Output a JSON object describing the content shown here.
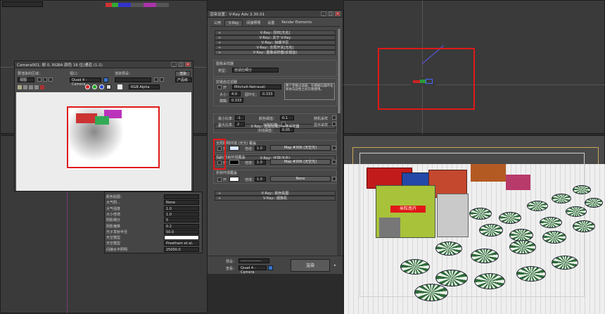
{
  "colors": {
    "highlight": "#e01818",
    "accent_blue": "#3b73c8",
    "viewport_bg": "#3a3a3a",
    "dialog_bg": "#444444"
  },
  "top_field": {
    "value": ""
  },
  "frame_window": {
    "title": "Camera001, 帧 0, RGBA 颜色 16 位/通道 (1:1)",
    "controls": {
      "minimize": "_",
      "maximize": "□",
      "close": "✕"
    },
    "labels": {
      "region": "要渲染的区域：",
      "viewport": "视口：",
      "preset": "渲染预设：",
      "render": "渲染"
    },
    "values": {
      "region": "视图",
      "viewport": "Quad 4 - Camera",
      "preset": "",
      "preset2": "产品级",
      "channel": "RGB Alpha"
    }
  },
  "render_dialog": {
    "title": "渲染设置：V-Ray Adv 2.30.01",
    "tabs": [
      "公用",
      "V-Ray",
      "间接照明",
      "设置",
      "Render Elements"
    ],
    "top_rollouts": [
      "V-Ray:: 授权[无名]",
      "V-Ray:: 关于 V-Ray",
      "V-Ray:: 帧缓冲区",
      "V-Ray:: 全局开关[无名]",
      "V-Ray:: 图像采样器(反锯齿)"
    ],
    "image_sampler": {
      "group": "图像采样器",
      "type_label": "类型：",
      "type_value": "自适应细分"
    },
    "aa_filter": {
      "group": "抗锯齿过滤器",
      "on_label": "开",
      "filter_value": "Mitchell-Netravali",
      "description": "两个参数过滤器：在模糊与圆环化和各向异性之间交替使用。",
      "size_label": "大小：",
      "size_value": "4.0",
      "ring_label": "圆环化：",
      "ring_value": "0.333",
      "blur_label": "模糊：",
      "blur_value": "0.333"
    },
    "adaptive_rollout": "V-Ray:: 自适应细分图像采样器",
    "adaptive": {
      "min_rate_label": "最小比率：",
      "min_rate": "-1",
      "max_rate_label": "最大比率：",
      "max_rate": "2",
      "clr_label": "颜色阈值：",
      "clr_value": "0.1",
      "obj_label": "对象轮廓",
      "normals_label": "法线阈值：",
      "normals_value": "0.05",
      "randomize_label": "随机采样",
      "show_label": "显示采样"
    },
    "env_rollout": "V-Ray:: 环境[无名]",
    "gi_env": {
      "group": "全局照明环境 (天光) 覆盖",
      "on_label": "开",
      "mult_label": "倍增：",
      "mult_value": "1.0",
      "map_label": "Map #306 (天空光)"
    },
    "refl_env": {
      "group": "反射/折射环境覆盖",
      "on_label": "开",
      "mult_label": "倍增：",
      "mult_value": "1.0",
      "map_label": "Map #306 (天空光)"
    },
    "refr_env": {
      "group": "折射环境覆盖",
      "on_label": "开",
      "mult_label": "倍增：",
      "mult_value": "1.0",
      "map_label": "None"
    },
    "bottom_rollouts": [
      "V-Ray:: 颜色贴图",
      "V-Ray:: 摄像机"
    ],
    "footer": {
      "preset_label": "预设：",
      "preset_value": "----------------",
      "view_label": "查看：",
      "view_value": "Quad 4 - Camera",
      "render_button": "渲染"
    }
  },
  "sun_panel": {
    "rows": [
      {
        "label": "颜色贴图：",
        "value": ""
      },
      {
        "label": "大气阴...",
        "value": "None"
      },
      {
        "label": "大气强度",
        "value": "1.0"
      },
      {
        "label": "大小倍增",
        "value": "1.0"
      },
      {
        "label": "阴影细分",
        "value": "5"
      },
      {
        "label": "阴影偏移",
        "value": "0.2"
      },
      {
        "label": "光子发射半径",
        "value": "50.0"
      },
      {
        "label": "天空模型",
        "value": ""
      },
      {
        "label": "天空模型",
        "value": "Preetham et al."
      },
      {
        "label": "间接水平照明",
        "value": "25000.0"
      }
    ]
  },
  "scene": {
    "sign_text": "米粒南卉"
  }
}
